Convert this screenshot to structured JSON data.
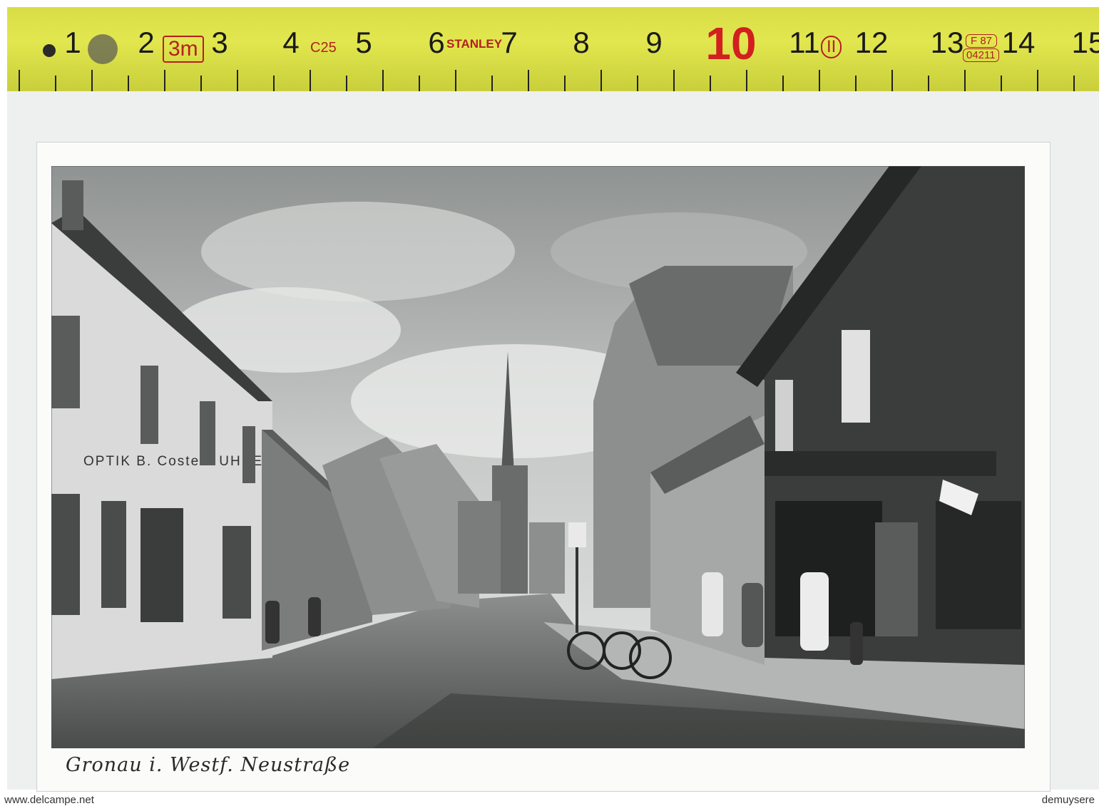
{
  "ruler": {
    "numbers": [
      "1",
      "2",
      "3",
      "4",
      "5",
      "6",
      "7",
      "8",
      "9",
      "10",
      "11",
      "12",
      "13",
      "14",
      "15"
    ],
    "length_label": "3m",
    "code_c25": "C25",
    "brand": "STANLEY",
    "class_mark": "II",
    "code_f87": "F 87",
    "code_04211": "04211"
  },
  "postcard": {
    "shop_sign_left": "OPTIK B. Costers UHREN",
    "caption": "Gronau i. Westf. Neustraße"
  },
  "watermarks": {
    "left": "www.delcampe.net",
    "right": "demuysere"
  }
}
